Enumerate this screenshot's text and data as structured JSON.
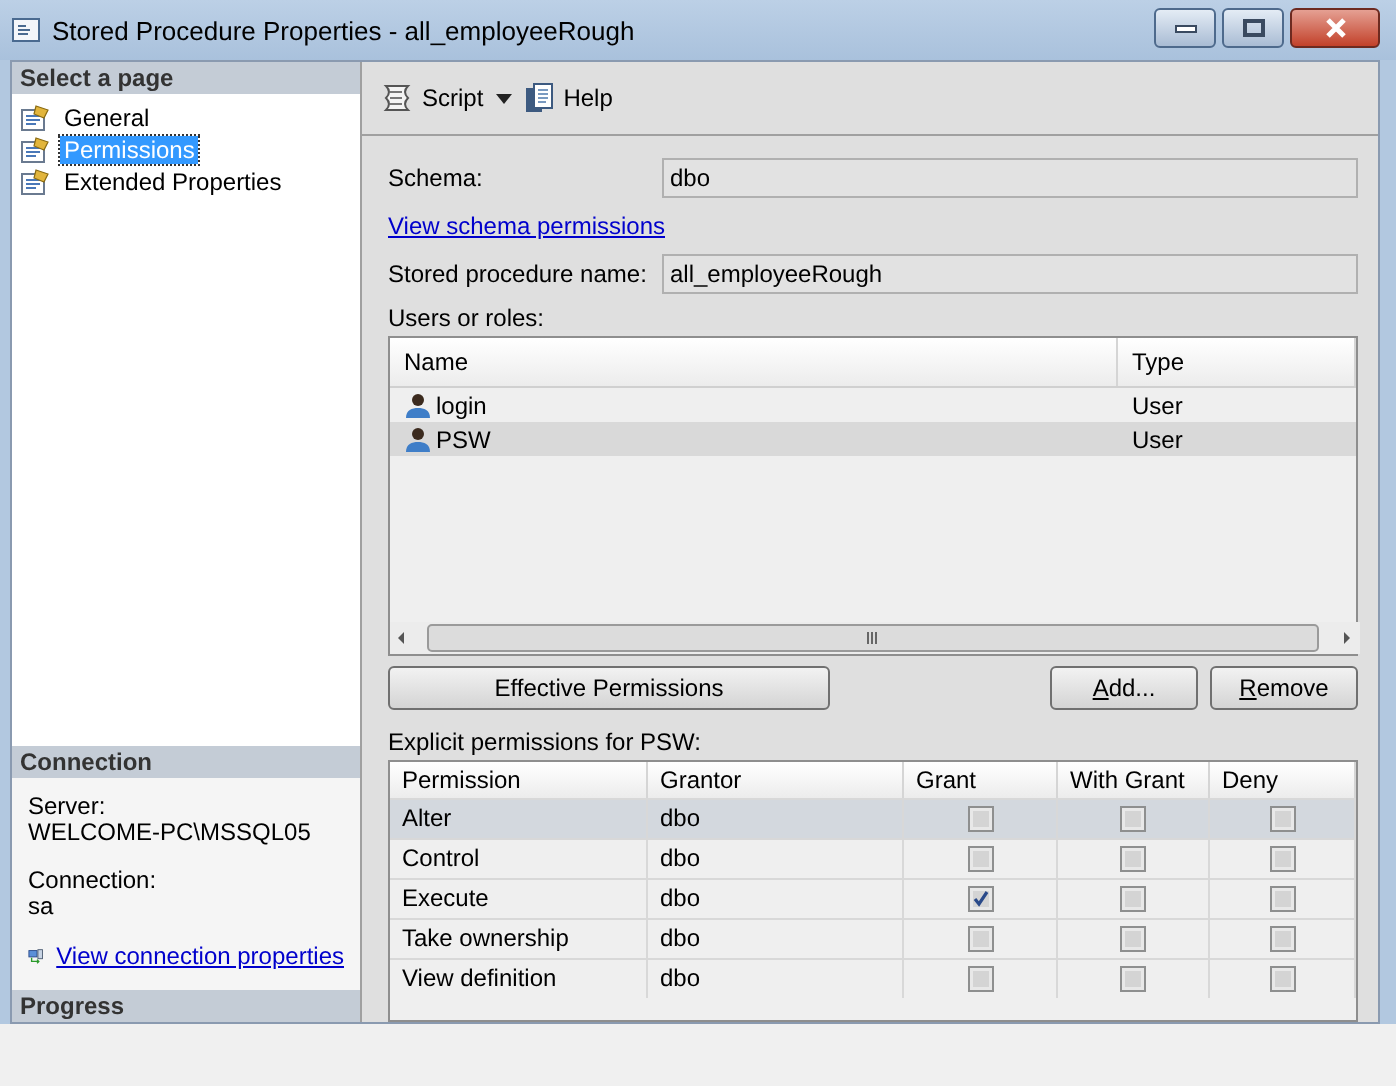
{
  "window": {
    "title": "Stored Procedure Properties - all_employeeRough"
  },
  "sidebar": {
    "header": "Select a page",
    "items": [
      {
        "label": "General",
        "selected": false
      },
      {
        "label": "Permissions",
        "selected": true
      },
      {
        "label": "Extended Properties",
        "selected": false
      }
    ]
  },
  "connection": {
    "header": "Connection",
    "server_label": "Server:",
    "server": "WELCOME-PC\\MSSQL05",
    "connection_label": "Connection:",
    "connection": "sa",
    "link": "View connection properties"
  },
  "progress": {
    "header": "Progress"
  },
  "toolbar": {
    "script": "Script",
    "help": "Help"
  },
  "schema": {
    "label": "Schema:",
    "value": "dbo",
    "link": "View schema permissions"
  },
  "procedure": {
    "label": "Stored procedure name:",
    "value": "all_employeeRough"
  },
  "users": {
    "label": "Users or roles:",
    "columns": [
      "Name",
      "Type"
    ],
    "rows": [
      {
        "name": "login",
        "type": "User",
        "selected": false
      },
      {
        "name": "PSW",
        "type": "User",
        "selected": true
      }
    ]
  },
  "buttons": {
    "effective": "Effective Permissions",
    "add": "Add...",
    "remove": "Remove"
  },
  "permissions": {
    "label": "Explicit permissions for PSW:",
    "columns": [
      "Permission",
      "Grantor",
      "Grant",
      "With Grant",
      "Deny"
    ],
    "rows": [
      {
        "permission": "Alter",
        "grantor": "dbo",
        "grant": false,
        "with_grant": false,
        "deny": false,
        "selected": true
      },
      {
        "permission": "Control",
        "grantor": "dbo",
        "grant": false,
        "with_grant": false,
        "deny": false,
        "selected": false
      },
      {
        "permission": "Execute",
        "grantor": "dbo",
        "grant": true,
        "with_grant": false,
        "deny": false,
        "selected": false
      },
      {
        "permission": "Take ownership",
        "grantor": "dbo",
        "grant": false,
        "with_grant": false,
        "deny": false,
        "selected": false
      },
      {
        "permission": "View definition",
        "grantor": "dbo",
        "grant": false,
        "with_grant": false,
        "deny": false,
        "selected": false
      }
    ]
  }
}
